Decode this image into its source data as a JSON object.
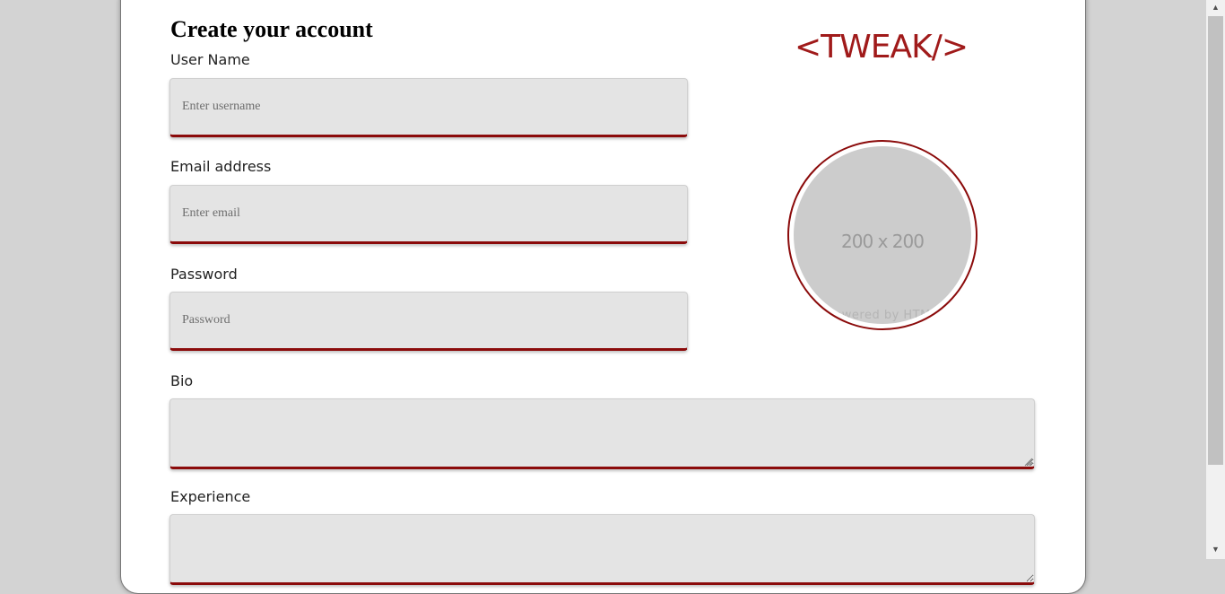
{
  "form": {
    "title": "Create your account",
    "fields": [
      {
        "label": "User Name",
        "placeholder": "Enter username",
        "value": ""
      },
      {
        "label": "Email address",
        "placeholder": "Enter email",
        "value": ""
      },
      {
        "label": "Password",
        "placeholder": "Password",
        "value": ""
      },
      {
        "label": "Bio",
        "placeholder": "",
        "value": ""
      },
      {
        "label": "Experience",
        "placeholder": "",
        "value": ""
      }
    ]
  },
  "brand": {
    "logo_text": "<TWEAK/>",
    "accent_color": "#8b0b0b"
  },
  "avatar": {
    "size_text": "200 x 200",
    "powered_text": "Powered by HTML"
  },
  "scrollbar": {
    "up_icon": "scroll-up-arrow-icon",
    "down_icon": "scroll-down-arrow-icon"
  }
}
